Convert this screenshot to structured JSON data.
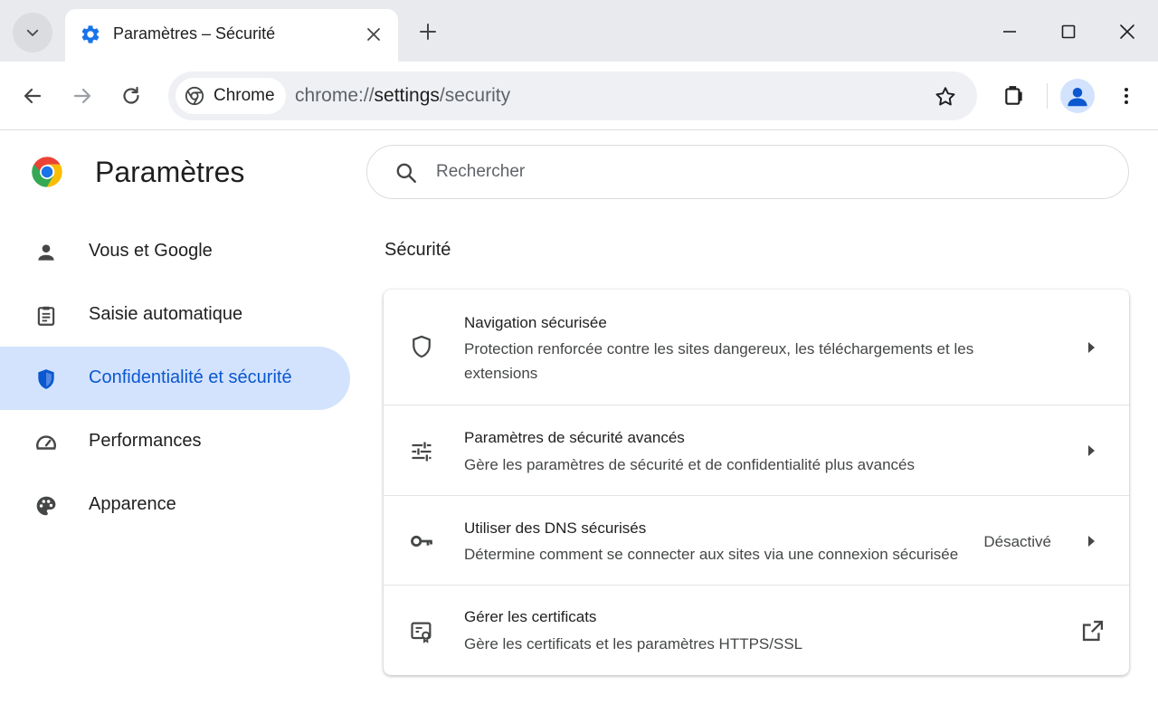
{
  "tab": {
    "title": "Paramètres – Sécurité"
  },
  "toolbar": {
    "chip_label": "Chrome",
    "url_prefix": "chrome://",
    "url_host": "settings",
    "url_path": "/security"
  },
  "header": {
    "title": "Paramètres",
    "search_placeholder": "Rechercher"
  },
  "sidebar": {
    "items": [
      {
        "label": "Vous et Google",
        "icon": "person-icon"
      },
      {
        "label": "Saisie automatique",
        "icon": "clipboard-icon"
      },
      {
        "label": "Confidentialité et sécurité",
        "icon": "shield-icon",
        "active": true
      },
      {
        "label": "Performances",
        "icon": "speedometer-icon"
      },
      {
        "label": "Apparence",
        "icon": "palette-icon"
      }
    ]
  },
  "main": {
    "section_title": "Sécurité",
    "rows": [
      {
        "title": "Navigation sécurisée",
        "subtitle": "Protection renforcée contre les sites dangereux, les téléchargements et les extensions",
        "icon": "shield-outline-icon"
      },
      {
        "title": "Paramètres de sécurité avancés",
        "subtitle": "Gère les paramètres de sécurité et de confidentialité plus avancés",
        "icon": "tune-icon"
      },
      {
        "title": "Utiliser des DNS sécurisés",
        "subtitle": "Détermine comment se connecter aux sites via une connexion sécurisée",
        "status": "Désactivé",
        "icon": "key-icon"
      },
      {
        "title": "Gérer les certificats",
        "subtitle": "Gère les certificats et les paramètres HTTPS/SSL",
        "icon": "certificate-icon"
      }
    ]
  },
  "colors": {
    "accent": "#0b57d0",
    "active_bg": "#d3e3fd",
    "tabstrip_bg": "#e8eaed",
    "omnibox_bg": "#eef0f4"
  }
}
